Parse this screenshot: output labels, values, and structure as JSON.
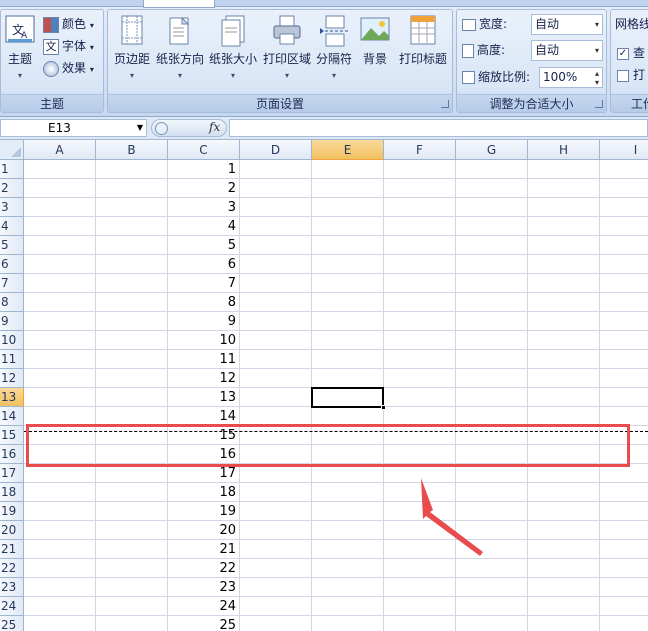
{
  "ribbon": {
    "theme_group": {
      "theme_button": "主题",
      "colors": "颜色",
      "fonts": "字体",
      "effects": "效果",
      "label": "主题"
    },
    "page_setup_group": {
      "margins": "页边距",
      "orientation": "纸张方向",
      "size": "纸张大小",
      "print_area": "打印区域",
      "breaks": "分隔符",
      "background": "背景",
      "print_titles": "打印标题",
      "label": "页面设置"
    },
    "scale_group": {
      "width_label": "宽度:",
      "width_value": "自动",
      "height_label": "高度:",
      "height_value": "自动",
      "scale_label": "缩放比例:",
      "scale_value": "100%",
      "label": "调整为合适大小"
    },
    "sheet_options_group": {
      "title": "网格线",
      "view": "查",
      "print": "打",
      "label": "工作"
    }
  },
  "formula_bar": {
    "name_box": "E13",
    "fx": "fx",
    "formula": ""
  },
  "sheet": {
    "columns": [
      "A",
      "B",
      "C",
      "D",
      "E",
      "F",
      "G",
      "H",
      "I"
    ],
    "selected_column": "E",
    "rows": [
      "1",
      "2",
      "3",
      "4",
      "5",
      "6",
      "7",
      "8",
      "9",
      "10",
      "11",
      "12",
      "13",
      "14",
      "15",
      "16",
      "17",
      "18",
      "19",
      "20",
      "21",
      "22",
      "23",
      "24",
      "25"
    ],
    "selected_row": "13",
    "column_c_values": [
      "1",
      "2",
      "3",
      "4",
      "5",
      "6",
      "7",
      "8",
      "9",
      "10",
      "11",
      "12",
      "13",
      "14",
      "15",
      "16",
      "17",
      "18",
      "19",
      "20",
      "21",
      "22",
      "23",
      "24",
      "25"
    ]
  },
  "colors": {
    "highlight": "#e84c4c",
    "selected_header": "#f1c15f"
  }
}
